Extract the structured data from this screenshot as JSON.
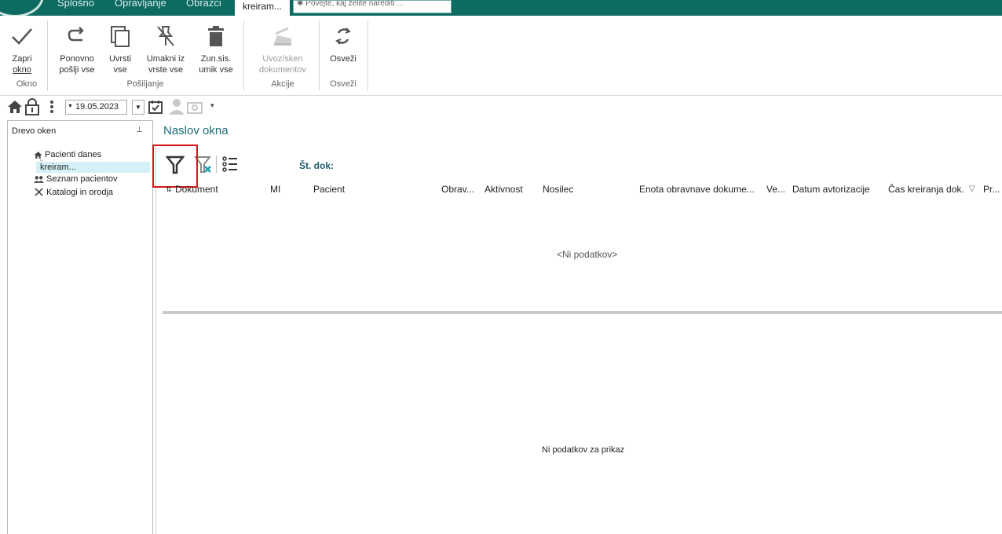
{
  "tabs": {
    "splosno": "Splošno",
    "opravljanje": "Opravljanje",
    "obrazci": "Obrazci",
    "active": "kreiram...",
    "search_placeholder": "Povejte, kaj želite narediti ..."
  },
  "ribbon": {
    "zapri": {
      "line1": "Zapri",
      "line2": "okno"
    },
    "ponovno": {
      "line1": "Ponovno",
      "line2": "pošlji vse"
    },
    "uvrsti": {
      "line1": "Uvrsti",
      "line2": "vse"
    },
    "umakni": {
      "line1": "Umakni iz",
      "line2": "vrste vse"
    },
    "zunsis": {
      "line1": "Zun.sis.",
      "line2": "umik vse"
    },
    "uvoz": {
      "line1": "Uvoz/sken",
      "line2": "dokumentov"
    },
    "osvezi": {
      "line1": "Osveži"
    },
    "groups": {
      "okno": "Okno",
      "posiljanje": "Pošiljanje",
      "akcije": "Akcije",
      "osvezi": "Osveži"
    }
  },
  "quickbar": {
    "date": "19.05.2023"
  },
  "sidebar": {
    "title": "Drevo oken",
    "items": [
      {
        "label": "Pacienti danes",
        "icon": "home-icon"
      },
      {
        "label": "kreiram..."
      },
      {
        "label": "Seznam pacientov",
        "icon": "people-icon"
      },
      {
        "label": "Katalogi in orodja",
        "icon": "tools-icon"
      }
    ]
  },
  "main": {
    "title": "Naslov okna",
    "stdok_label": "Št. dok:",
    "columns": [
      "Dokument",
      "MI",
      "Pacient",
      "Obrav...",
      "Aktivnost",
      "Nosilec",
      "Enota obravnave dokume...",
      "Ve...",
      "Datum avtorizacije",
      "Čas kreiranja dok.",
      "Pr..."
    ],
    "empty_grid": "<Ni podatkov>",
    "empty_preview": "Ni podatkov za prikaz"
  },
  "colors": {
    "accent": "#0e6b61",
    "highlight": "#d11a1a",
    "selection": "#d4f1f7"
  }
}
